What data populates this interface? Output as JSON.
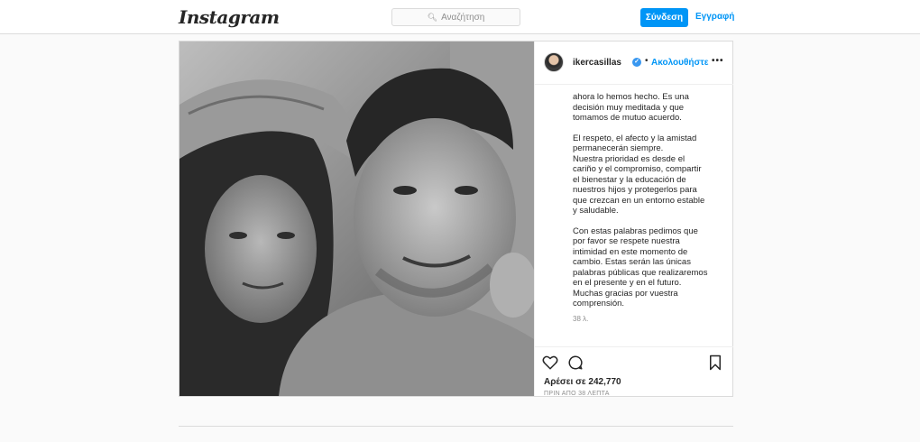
{
  "header": {
    "logo_text": "Instagram",
    "search": {
      "icon": "search-icon",
      "placeholder": "Αναζήτηση"
    },
    "login_label": "Σύνδεση",
    "signup_label": "Εγγραφή"
  },
  "post": {
    "photo": {
      "kind": "black-and-white selfie photograph"
    },
    "author": {
      "username": "ikercasillas",
      "verified": true,
      "separator": "•",
      "follow_label": "Ακολουθήστε"
    },
    "more_label": "•••",
    "caption_paragraphs": [
      "ahora lo hemos hecho. Es una\ndecisión muy meditada y que\ntomamos de mutuo acuerdo.",
      "El respeto, el afecto y la amistad\npermanecerán siempre.\nNuestra prioridad es desde el\ncariño y el compromiso, compartir\nel bienestar y la educación de\nnuestros hijos y protegerlos para\nque crezcan en un entorno estable\ny saludable.",
      "Con estas palabras pedimos que\npor favor se respete nuestra\nintimidad en este momento de\ncambio. Estas serán las únicas\npalabras públicas que realizaremos\nen el presente y en el futuro.\nMuchas gracias por vuestra\ncomprensión."
    ],
    "caption_time": "38 λ.",
    "likes_text": "Αρέσει σε 242,770",
    "posted_time": "ΠΡΙΝ ΑΠΟ 38 ΛΕΠΤΑ",
    "icons": {
      "like": "heart-icon",
      "comment": "comment-icon",
      "save": "bookmark-icon"
    }
  },
  "colors": {
    "accent": "#0095f6",
    "border": "#dbdbdb",
    "background": "#fafafa"
  }
}
